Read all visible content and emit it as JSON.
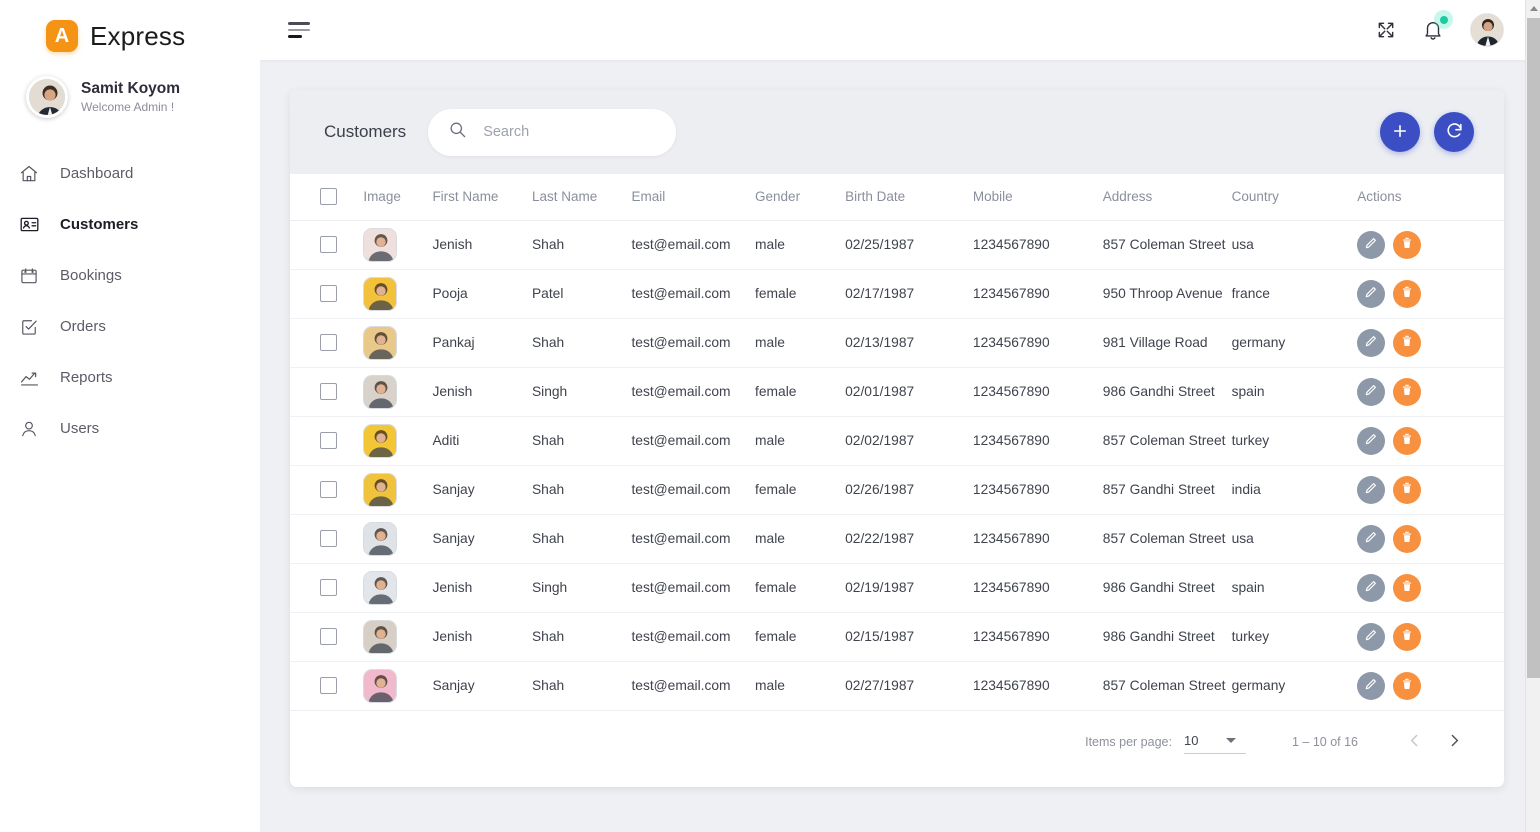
{
  "brand": {
    "mark_letter": "A",
    "name": "Express",
    "mark_color": "#f59414"
  },
  "profile": {
    "name": "Samit Koyom",
    "subtitle": "Welcome Admin !"
  },
  "sidebar": {
    "items": [
      {
        "label": "Dashboard",
        "icon": "home-icon",
        "active": false
      },
      {
        "label": "Customers",
        "icon": "contact-card-icon",
        "active": true
      },
      {
        "label": "Bookings",
        "icon": "calendar-icon",
        "active": false
      },
      {
        "label": "Orders",
        "icon": "checklist-icon",
        "active": false
      },
      {
        "label": "Reports",
        "icon": "trend-up-icon",
        "active": false
      },
      {
        "label": "Users",
        "icon": "user-icon",
        "active": false
      }
    ]
  },
  "topbar": {
    "menu_icon": "hamburger-icon",
    "fullscreen_icon": "fullscreen-expand-icon",
    "notifications_icon": "bell-icon",
    "notification_badge_color": "#20c9a6",
    "avatar_icon": "user-avatar"
  },
  "card": {
    "title": "Customers",
    "search": {
      "placeholder": "Search",
      "value": "",
      "icon": "search-icon"
    },
    "add_button": {
      "label": "+",
      "icon": "plus-icon",
      "color": "#3b4ec4"
    },
    "refresh_button": {
      "label": "",
      "icon": "refresh-icon",
      "color": "#3b4ec4"
    }
  },
  "table": {
    "columns": [
      "Image",
      "First Name",
      "Last Name",
      "Email",
      "Gender",
      "Birth Date",
      "Mobile",
      "Address",
      "Country",
      "Actions"
    ],
    "select_all_checkbox": false,
    "row_actions": {
      "edit_icon": "pencil-icon",
      "edit_color": "#8d98a8",
      "delete_icon": "trash-icon",
      "delete_color": "#f7913f"
    },
    "rows": [
      {
        "first_name": "Jenish",
        "last_name": "Shah",
        "email": "test@email.com",
        "gender": "male",
        "birth_date": "02/25/1987",
        "mobile": "1234567890",
        "address": "857 Coleman Street",
        "country": "usa",
        "avatar_bg": "#efe0de"
      },
      {
        "first_name": "Pooja",
        "last_name": "Patel",
        "email": "test@email.com",
        "gender": "female",
        "birth_date": "02/17/1987",
        "mobile": "1234567890",
        "address": "950 Throop Avenue",
        "country": "france",
        "avatar_bg": "#f3c23d"
      },
      {
        "first_name": "Pankaj",
        "last_name": "Shah",
        "email": "test@email.com",
        "gender": "male",
        "birth_date": "02/13/1987",
        "mobile": "1234567890",
        "address": "981 Village Road",
        "country": "germany",
        "avatar_bg": "#e8c98a"
      },
      {
        "first_name": "Jenish",
        "last_name": "Singh",
        "email": "test@email.com",
        "gender": "female",
        "birth_date": "02/01/1987",
        "mobile": "1234567890",
        "address": "986 Gandhi Street",
        "country": "spain",
        "avatar_bg": "#d8d2cb"
      },
      {
        "first_name": "Aditi",
        "last_name": "Shah",
        "email": "test@email.com",
        "gender": "male",
        "birth_date": "02/02/1987",
        "mobile": "1234567890",
        "address": "857 Coleman Street",
        "country": "turkey",
        "avatar_bg": "#f2c634"
      },
      {
        "first_name": "Sanjay",
        "last_name": "Shah",
        "email": "test@email.com",
        "gender": "female",
        "birth_date": "02/26/1987",
        "mobile": "1234567890",
        "address": "857 Gandhi Street",
        "country": "india",
        "avatar_bg": "#f0c33c"
      },
      {
        "first_name": "Sanjay",
        "last_name": "Shah",
        "email": "test@email.com",
        "gender": "male",
        "birth_date": "02/22/1987",
        "mobile": "1234567890",
        "address": "857 Coleman Street",
        "country": "usa",
        "avatar_bg": "#dfe3e8"
      },
      {
        "first_name": "Jenish",
        "last_name": "Singh",
        "email": "test@email.com",
        "gender": "female",
        "birth_date": "02/19/1987",
        "mobile": "1234567890",
        "address": "986 Gandhi Street",
        "country": "spain",
        "avatar_bg": "#e2e6ea"
      },
      {
        "first_name": "Jenish",
        "last_name": "Shah",
        "email": "test@email.com",
        "gender": "female",
        "birth_date": "02/15/1987",
        "mobile": "1234567890",
        "address": "986 Gandhi Street",
        "country": "turkey",
        "avatar_bg": "#d7cfc6"
      },
      {
        "first_name": "Sanjay",
        "last_name": "Shah",
        "email": "test@email.com",
        "gender": "male",
        "birth_date": "02/27/1987",
        "mobile": "1234567890",
        "address": "857 Coleman Street",
        "country": "germany",
        "avatar_bg": "#f0b9cc"
      }
    ]
  },
  "paginator": {
    "items_per_page_label": "Items per page:",
    "items_per_page_value": "10",
    "range_label": "1 – 10 of 16",
    "prev_icon": "chevron-left-icon",
    "next_icon": "chevron-right-icon"
  }
}
